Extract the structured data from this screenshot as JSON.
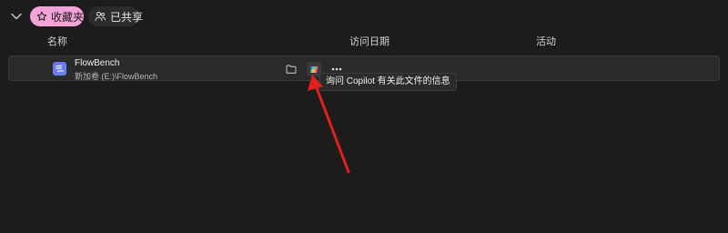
{
  "top_bar": {
    "favorites_label": "收藏夹",
    "shared_label": "已共享",
    "favorites_icon": "star-icon",
    "shared_icon": "people-icon"
  },
  "columns": {
    "name": "名称",
    "access_date": "访问日期",
    "activity": "活动"
  },
  "file": {
    "name": "FlowBench",
    "path": "新加卷 (E:)\\FlowBench",
    "icon": "flowbench-app-icon"
  },
  "row_actions": {
    "open_folder_icon": "folder-icon",
    "copilot_icon": "copilot-icon",
    "more_icon": "more-icon"
  },
  "tooltip": {
    "text": "询问 Copilot 有关此文件的信息"
  },
  "colors": {
    "background": "#1c1c1c",
    "favorites_pill": "#f3a3d9",
    "row_background": "#2a2a2a",
    "annotation_arrow": "#e0201c"
  }
}
